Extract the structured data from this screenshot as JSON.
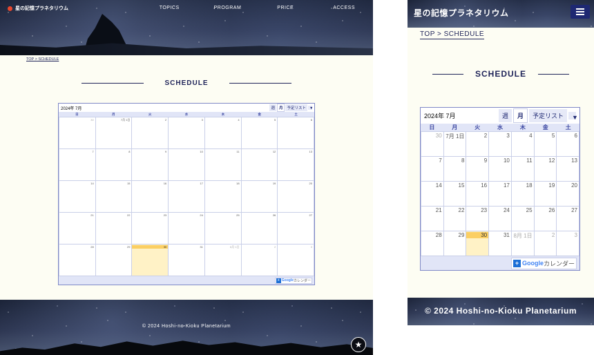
{
  "site": {
    "logo": "星の記憶プラネタリウム",
    "copyright": "© 2024 Hoshi-no-Kioku Planetarium",
    "nav": [
      "TOPICS",
      "PROGRAM",
      "PRICE",
      "ACCESS"
    ],
    "breadcrumb": "TOP > SCHEDULE",
    "section_title": "SCHEDULE",
    "accent_color": "#1e2358"
  },
  "calendar": {
    "month_label": "2024年 7月",
    "view_week": "週",
    "view_month": "月",
    "view_list": "予定リスト",
    "weekdays": [
      "日",
      "月",
      "火",
      "水",
      "木",
      "金",
      "土"
    ],
    "days": [
      "30",
      "7月 1日",
      "2",
      "3",
      "4",
      "5",
      "6",
      "7",
      "8",
      "9",
      "10",
      "11",
      "12",
      "13",
      "14",
      "15",
      "16",
      "17",
      "18",
      "19",
      "20",
      "21",
      "22",
      "23",
      "24",
      "25",
      "26",
      "27",
      "28",
      "29",
      "30",
      "31",
      "8月 1日",
      "2",
      "3"
    ],
    "outside_days": [
      0,
      32,
      33,
      34
    ],
    "today_index": 30,
    "today_color": "#fbcf63",
    "google_g": "Google",
    "google_tail": "カレンダー",
    "plus": "+"
  },
  "icons": {
    "menu": "hamburger-menu-icon",
    "page_top": "page-top-icon"
  }
}
